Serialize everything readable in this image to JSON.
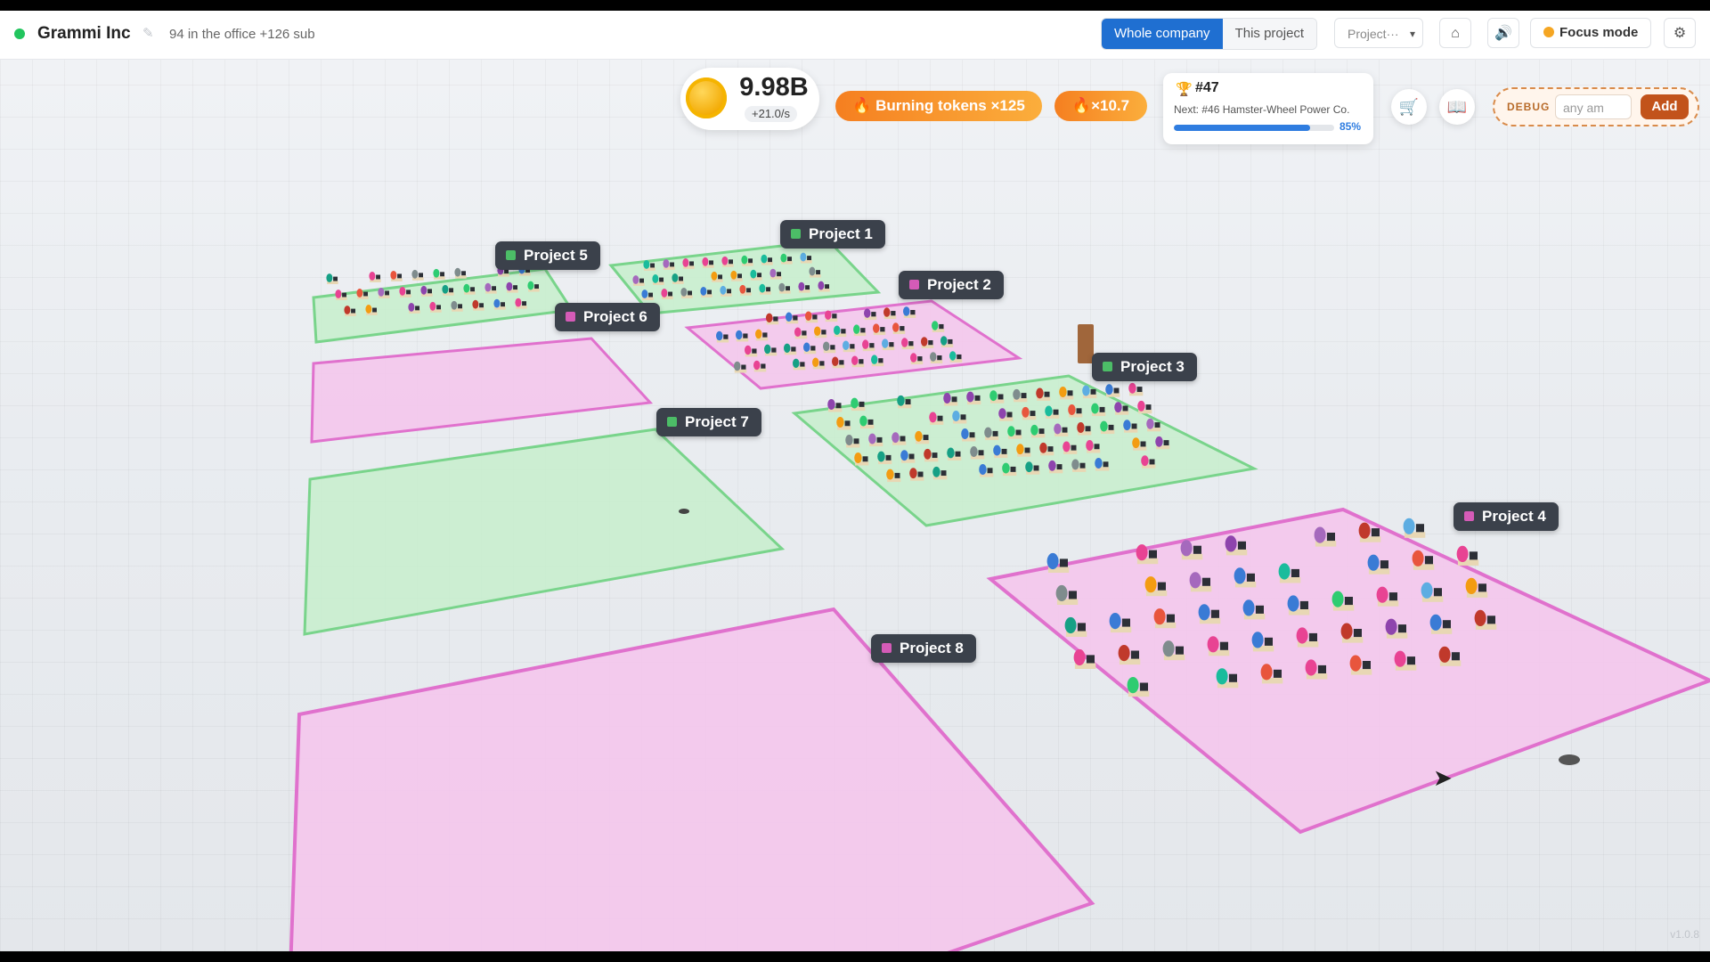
{
  "header": {
    "company_name": "Grammi Inc",
    "headcount": "94 in the office +126 sub",
    "status_color": "#22c55e",
    "view_tabs": [
      {
        "label": "Whole company",
        "active": true
      },
      {
        "label": "This project",
        "active": false
      }
    ],
    "project_select": "Project···",
    "focus_label": "Focus mode",
    "icons": [
      "bell-icon",
      "volume-icon",
      "settings-icon"
    ]
  },
  "stats": {
    "coins": "9.98B",
    "rate": "+21.0/s",
    "burning_label": "🔥 Burning tokens ×125",
    "multiplier": "🔥×10.7"
  },
  "rank": {
    "number": "#47",
    "next": "Next: #46 Hamster-Wheel Power Co.",
    "progress_label": "85%",
    "progress": 0.85
  },
  "debug": {
    "label": "DEBUG",
    "placeholder": "any am",
    "add_label": "Add"
  },
  "projects": [
    {
      "name": "Project 1",
      "color": "#4cbd67"
    },
    {
      "name": "Project 2",
      "color": "#d45bb7"
    },
    {
      "name": "Project 3",
      "color": "#4cbd67"
    },
    {
      "name": "Project 4",
      "color": "#d45bb7"
    },
    {
      "name": "Project 5",
      "color": "#4cbd67"
    },
    {
      "name": "Project 6",
      "color": "#d45bb7"
    },
    {
      "name": "Project 7",
      "color": "#4cbd67"
    },
    {
      "name": "Project 8",
      "color": "#d45bb7"
    }
  ],
  "version": "v1.0.8"
}
